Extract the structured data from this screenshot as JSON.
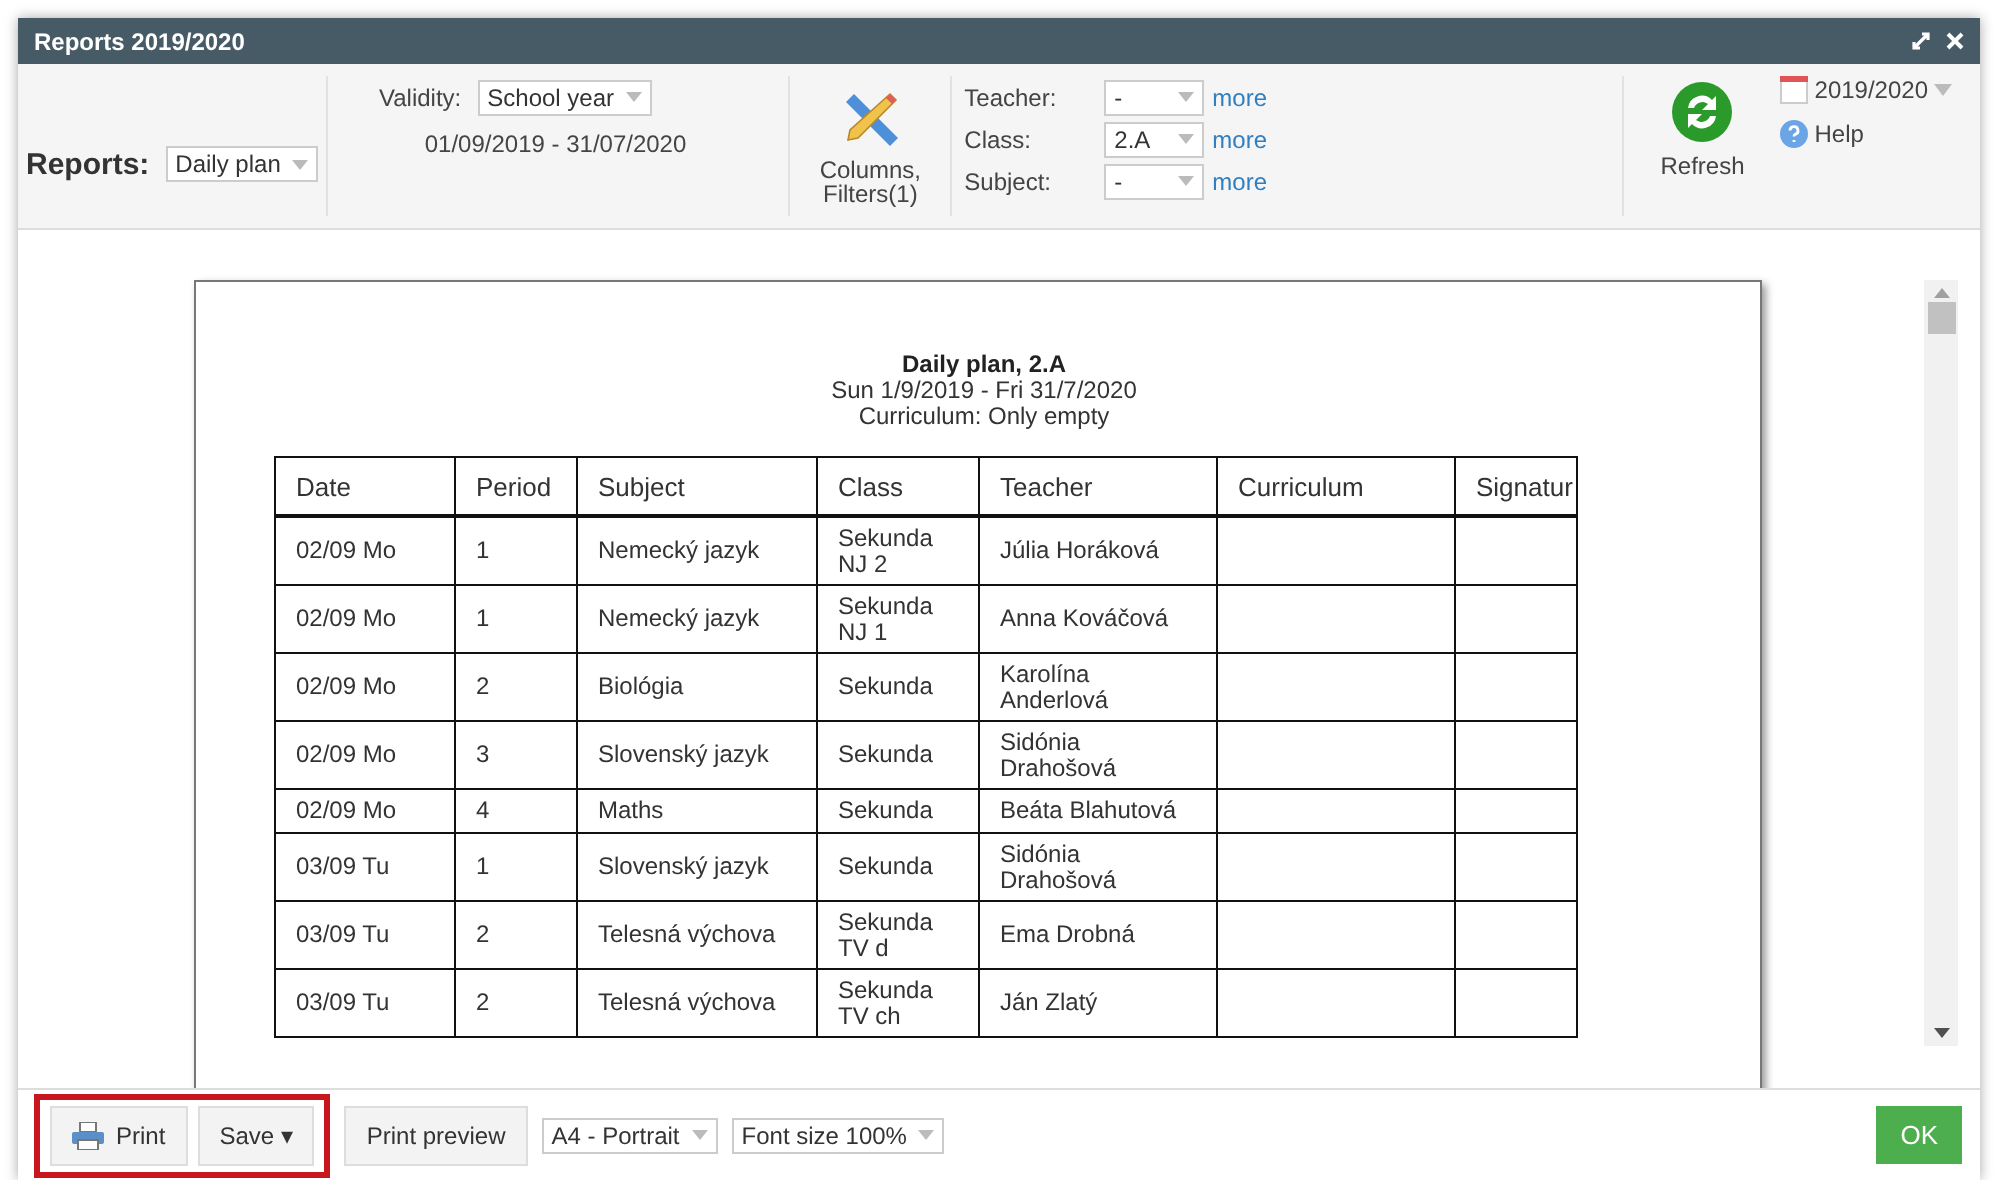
{
  "window": {
    "title": "Reports 2019/2020"
  },
  "toolbar": {
    "reports": {
      "label": "Reports:",
      "value": "Daily plan"
    },
    "validity": {
      "label": "Validity:",
      "value": "School year",
      "range": "01/09/2019 - 31/07/2020"
    },
    "columns_button": {
      "label": "Columns, Filters(1)"
    },
    "filters": [
      {
        "label": "Teacher:",
        "value": "-",
        "link": "more"
      },
      {
        "label": "Class:",
        "value": "2.A",
        "link": "more"
      },
      {
        "label": "Subject:",
        "value": "-",
        "link": "more"
      }
    ],
    "refresh": "Refresh",
    "year": "2019/2020",
    "help": "Help"
  },
  "report": {
    "title": "Daily plan, 2.A",
    "subtitle": "Sun 1/9/2019 - Fri 31/7/2020",
    "note": "Curriculum: Only empty",
    "columns": [
      "Date",
      "Period",
      "Subject",
      "Class",
      "Teacher",
      "Curriculum",
      "Signatur"
    ],
    "rows": [
      [
        "02/09 Mo",
        "1",
        "Nemecký jazyk",
        "Sekunda NJ 2",
        "Júlia Horáková",
        "",
        ""
      ],
      [
        "02/09 Mo",
        "1",
        "Nemecký jazyk",
        "Sekunda NJ 1",
        "Anna Kováčová",
        "",
        ""
      ],
      [
        "02/09 Mo",
        "2",
        "Biológia",
        "Sekunda",
        "Karolína Anderlová",
        "",
        ""
      ],
      [
        "02/09 Mo",
        "3",
        "Slovenský jazyk",
        "Sekunda",
        "Sidónia Drahošová",
        "",
        ""
      ],
      [
        "02/09 Mo",
        "4",
        "Maths",
        "Sekunda",
        "Beáta Blahutová",
        "",
        ""
      ],
      [
        "03/09 Tu",
        "1",
        "Slovenský jazyk",
        "Sekunda",
        "Sidónia Drahošová",
        "",
        ""
      ],
      [
        "03/09 Tu",
        "2",
        "Telesná výchova",
        "Sekunda TV d",
        "Ema Drobná",
        "",
        ""
      ],
      [
        "03/09 Tu",
        "2",
        "Telesná výchova",
        "Sekunda TV ch",
        "Ján Zlatý",
        "",
        ""
      ]
    ]
  },
  "footer": {
    "buttons": [
      {
        "kind": "print",
        "label": "Print",
        "highlighted": true
      },
      {
        "kind": "plain",
        "label": "Save ▾",
        "highlighted": true
      },
      {
        "kind": "plain",
        "label": "Print preview",
        "highlighted": false
      }
    ],
    "selects": [
      "A4 - Portrait",
      "Font size 100%"
    ],
    "ok": "OK"
  }
}
